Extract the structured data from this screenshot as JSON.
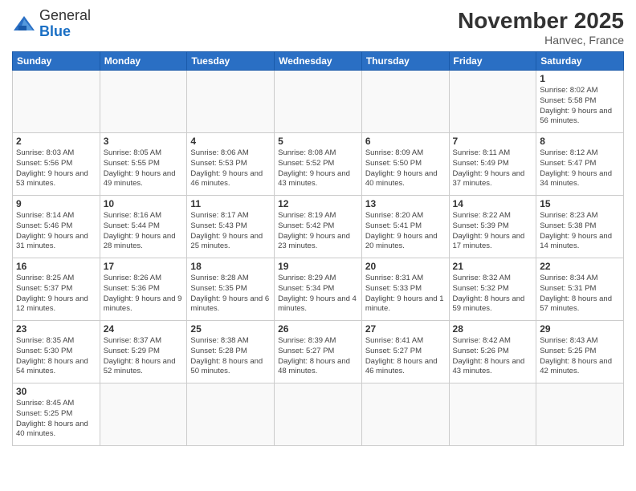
{
  "logo": {
    "text_general": "General",
    "text_blue": "Blue"
  },
  "title": {
    "month_year": "November 2025",
    "location": "Hanvec, France"
  },
  "weekdays": [
    "Sunday",
    "Monday",
    "Tuesday",
    "Wednesday",
    "Thursday",
    "Friday",
    "Saturday"
  ],
  "weeks": [
    [
      {
        "day": "",
        "info": ""
      },
      {
        "day": "",
        "info": ""
      },
      {
        "day": "",
        "info": ""
      },
      {
        "day": "",
        "info": ""
      },
      {
        "day": "",
        "info": ""
      },
      {
        "day": "",
        "info": ""
      },
      {
        "day": "1",
        "info": "Sunrise: 8:02 AM\nSunset: 5:58 PM\nDaylight: 9 hours and 56 minutes."
      }
    ],
    [
      {
        "day": "2",
        "info": "Sunrise: 8:03 AM\nSunset: 5:56 PM\nDaylight: 9 hours and 53 minutes."
      },
      {
        "day": "3",
        "info": "Sunrise: 8:05 AM\nSunset: 5:55 PM\nDaylight: 9 hours and 49 minutes."
      },
      {
        "day": "4",
        "info": "Sunrise: 8:06 AM\nSunset: 5:53 PM\nDaylight: 9 hours and 46 minutes."
      },
      {
        "day": "5",
        "info": "Sunrise: 8:08 AM\nSunset: 5:52 PM\nDaylight: 9 hours and 43 minutes."
      },
      {
        "day": "6",
        "info": "Sunrise: 8:09 AM\nSunset: 5:50 PM\nDaylight: 9 hours and 40 minutes."
      },
      {
        "day": "7",
        "info": "Sunrise: 8:11 AM\nSunset: 5:49 PM\nDaylight: 9 hours and 37 minutes."
      },
      {
        "day": "8",
        "info": "Sunrise: 8:12 AM\nSunset: 5:47 PM\nDaylight: 9 hours and 34 minutes."
      }
    ],
    [
      {
        "day": "9",
        "info": "Sunrise: 8:14 AM\nSunset: 5:46 PM\nDaylight: 9 hours and 31 minutes."
      },
      {
        "day": "10",
        "info": "Sunrise: 8:16 AM\nSunset: 5:44 PM\nDaylight: 9 hours and 28 minutes."
      },
      {
        "day": "11",
        "info": "Sunrise: 8:17 AM\nSunset: 5:43 PM\nDaylight: 9 hours and 25 minutes."
      },
      {
        "day": "12",
        "info": "Sunrise: 8:19 AM\nSunset: 5:42 PM\nDaylight: 9 hours and 23 minutes."
      },
      {
        "day": "13",
        "info": "Sunrise: 8:20 AM\nSunset: 5:41 PM\nDaylight: 9 hours and 20 minutes."
      },
      {
        "day": "14",
        "info": "Sunrise: 8:22 AM\nSunset: 5:39 PM\nDaylight: 9 hours and 17 minutes."
      },
      {
        "day": "15",
        "info": "Sunrise: 8:23 AM\nSunset: 5:38 PM\nDaylight: 9 hours and 14 minutes."
      }
    ],
    [
      {
        "day": "16",
        "info": "Sunrise: 8:25 AM\nSunset: 5:37 PM\nDaylight: 9 hours and 12 minutes."
      },
      {
        "day": "17",
        "info": "Sunrise: 8:26 AM\nSunset: 5:36 PM\nDaylight: 9 hours and 9 minutes."
      },
      {
        "day": "18",
        "info": "Sunrise: 8:28 AM\nSunset: 5:35 PM\nDaylight: 9 hours and 6 minutes."
      },
      {
        "day": "19",
        "info": "Sunrise: 8:29 AM\nSunset: 5:34 PM\nDaylight: 9 hours and 4 minutes."
      },
      {
        "day": "20",
        "info": "Sunrise: 8:31 AM\nSunset: 5:33 PM\nDaylight: 9 hours and 1 minute."
      },
      {
        "day": "21",
        "info": "Sunrise: 8:32 AM\nSunset: 5:32 PM\nDaylight: 8 hours and 59 minutes."
      },
      {
        "day": "22",
        "info": "Sunrise: 8:34 AM\nSunset: 5:31 PM\nDaylight: 8 hours and 57 minutes."
      }
    ],
    [
      {
        "day": "23",
        "info": "Sunrise: 8:35 AM\nSunset: 5:30 PM\nDaylight: 8 hours and 54 minutes."
      },
      {
        "day": "24",
        "info": "Sunrise: 8:37 AM\nSunset: 5:29 PM\nDaylight: 8 hours and 52 minutes."
      },
      {
        "day": "25",
        "info": "Sunrise: 8:38 AM\nSunset: 5:28 PM\nDaylight: 8 hours and 50 minutes."
      },
      {
        "day": "26",
        "info": "Sunrise: 8:39 AM\nSunset: 5:27 PM\nDaylight: 8 hours and 48 minutes."
      },
      {
        "day": "27",
        "info": "Sunrise: 8:41 AM\nSunset: 5:27 PM\nDaylight: 8 hours and 46 minutes."
      },
      {
        "day": "28",
        "info": "Sunrise: 8:42 AM\nSunset: 5:26 PM\nDaylight: 8 hours and 43 minutes."
      },
      {
        "day": "29",
        "info": "Sunrise: 8:43 AM\nSunset: 5:25 PM\nDaylight: 8 hours and 42 minutes."
      }
    ],
    [
      {
        "day": "30",
        "info": "Sunrise: 8:45 AM\nSunset: 5:25 PM\nDaylight: 8 hours and 40 minutes."
      },
      {
        "day": "",
        "info": ""
      },
      {
        "day": "",
        "info": ""
      },
      {
        "day": "",
        "info": ""
      },
      {
        "day": "",
        "info": ""
      },
      {
        "day": "",
        "info": ""
      },
      {
        "day": "",
        "info": ""
      }
    ]
  ]
}
